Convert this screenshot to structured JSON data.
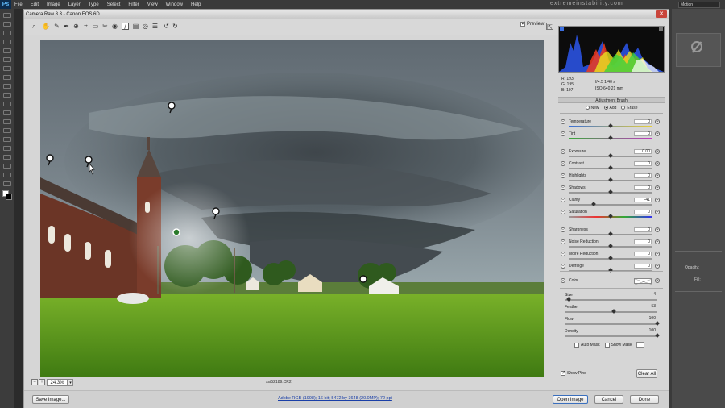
{
  "ps_menu": [
    "File",
    "Edit",
    "Image",
    "Layer",
    "Type",
    "Select",
    "Filter",
    "View",
    "Window",
    "Help"
  ],
  "ps_logo": "Ps",
  "watermark": "extremeinstability.com",
  "ps_workspace": "Motion",
  "ps_panel": {
    "opacity_label": "Opacity:",
    "fill_label": "Fill:"
  },
  "window_title": "Camera Raw 8.3 - Canon EOS 6D",
  "close_glyph": "✕",
  "toolbar": {
    "preview_label": "Preview",
    "preview_checked": true
  },
  "image": {
    "zoom": "24.3%",
    "filename": "sst52189.CR2"
  },
  "histogram": {
    "rgb": {
      "r": "R: 193",
      "g": "G: 195",
      "b": "B: 197"
    },
    "exposure": {
      "aperture_shutter": "f/4.5    1/40 s",
      "iso_focal": "ISO 640    21 mm"
    }
  },
  "adjustment_brush": {
    "title": "Adjustment Brush",
    "modes": [
      {
        "label": "New",
        "selected": false
      },
      {
        "label": "Add",
        "selected": true
      },
      {
        "label": "Erase",
        "selected": false
      }
    ],
    "sliders": [
      {
        "label": "Temperature",
        "value": "0",
        "pos": 0.5
      },
      {
        "label": "Tint",
        "value": "0",
        "pos": 0.5
      },
      {
        "label": "Exposure",
        "value": "0.00",
        "pos": 0.5
      },
      {
        "label": "Contrast",
        "value": "0",
        "pos": 0.5
      },
      {
        "label": "Highlights",
        "value": "0",
        "pos": 0.5
      },
      {
        "label": "Shadows",
        "value": "0",
        "pos": 0.5
      },
      {
        "label": "Clarity",
        "value": "-41",
        "pos": 0.3
      },
      {
        "label": "Saturation",
        "value": "0",
        "pos": 0.5
      },
      {
        "label": "Sharpness",
        "value": "0",
        "pos": 0.5
      },
      {
        "label": "Noise Reduction",
        "value": "0",
        "pos": 0.5
      },
      {
        "label": "Moire Reduction",
        "value": "0",
        "pos": 0.5
      },
      {
        "label": "Defringe",
        "value": "0",
        "pos": 0.5
      }
    ],
    "color_label": "Color",
    "brush": [
      {
        "label": "Size",
        "value": "4",
        "pos": 0.04
      },
      {
        "label": "Feather",
        "value": "53",
        "pos": 0.53
      },
      {
        "label": "Flow",
        "value": "100",
        "pos": 1.0
      },
      {
        "label": "Density",
        "value": "100",
        "pos": 1.0
      }
    ],
    "auto_mask": "Auto Mask",
    "show_mask": "Show Mask",
    "show_pins": "Show Pins",
    "clear_all": "Clear All"
  },
  "footer": {
    "save_image": "Save Image...",
    "workflow": "Adobe RGB (1998); 16 bit; 5472 by 3648 (20.0MP); 72 ppi",
    "open_image": "Open Image",
    "cancel": "Cancel",
    "done": "Done"
  }
}
